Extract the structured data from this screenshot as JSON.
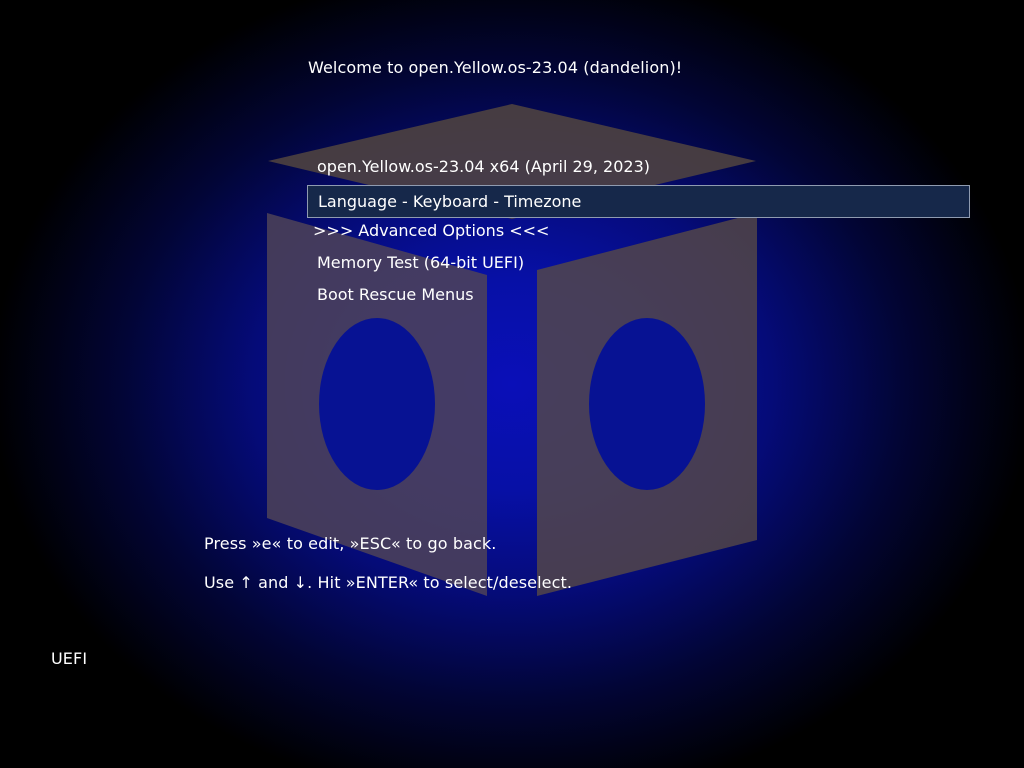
{
  "screen": {
    "welcome_text": "Welcome to open.Yellow.os-23.04 (dandelion)!"
  },
  "menu": {
    "items": [
      {
        "label": "open.Yellow.os-23.04 x64 (April 29, 2023)",
        "selected": false
      },
      {
        "label": "Language - Keyboard - Timezone",
        "selected": true
      },
      {
        "label": ">>> Advanced Options <<<",
        "selected": false
      },
      {
        "label": "Memory Test (64-bit UEFI)",
        "selected": false
      },
      {
        "label": "Boot Rescue Menus",
        "selected": false
      }
    ]
  },
  "hints": {
    "edit": "Press »e« to edit, »ESC« to go back.",
    "navigate": "Use ↑ and ↓. Hit »ENTER« to select/deselect."
  },
  "footer": {
    "firmware_label": "UEFI"
  },
  "colors": {
    "background_center": "#0a0fb8",
    "background_edge": "#000000",
    "logo_fill": "#4a4060",
    "selection_fill": "#16284a",
    "selection_border": "#8f9bb0",
    "text": "#ffffff"
  },
  "icons": {
    "logo": "box-logo-icon"
  }
}
